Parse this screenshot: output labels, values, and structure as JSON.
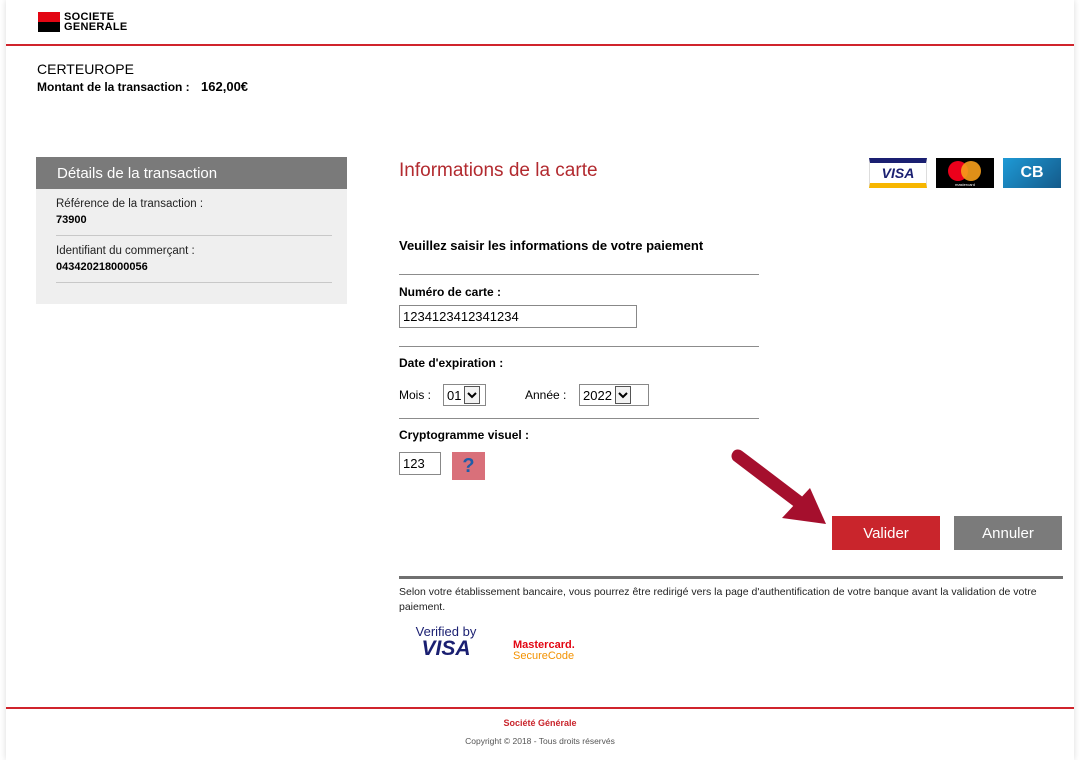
{
  "header": {
    "logo_line1": "SOCIETE",
    "logo_line2": "GENERALE"
  },
  "merchant": {
    "name": "CERTEUROPE",
    "amount_label": "Montant de la transaction :",
    "amount_value": "162,00€"
  },
  "details": {
    "title": "Détails de la transaction",
    "rows": [
      {
        "label": "Référence de la transaction :",
        "value": "73900"
      },
      {
        "label": "Identifiant du commerçant :",
        "value": "043420218000056"
      }
    ]
  },
  "form": {
    "title": "Informations de la carte",
    "prompt": "Veuillez saisir les informations de votre paiement",
    "card_number_label": "Numéro de carte :",
    "card_number_value": "1234123412341234",
    "expiry_label": "Date d'expiration :",
    "month_label": "Mois :",
    "month_value": "01",
    "year_label": "Année :",
    "year_value": "2022",
    "cvv_label": "Cryptogramme visuel :",
    "cvv_value": "123",
    "help_label": "?",
    "validate_label": "Valider",
    "cancel_label": "Annuler"
  },
  "brands": {
    "visa": "VISA",
    "mastercard": "mastercard",
    "cb": "CB"
  },
  "notice": "Selon votre établissement bancaire, vous pourrez être redirigé vers la page d'authentification de votre banque avant la validation de votre paiement.",
  "security": {
    "vbv_line1": "Verified by",
    "vbv_line2": "VISA",
    "mc_line1": "Mastercard.",
    "mc_line2": "SecureCode"
  },
  "footer": {
    "brand": "Société Générale",
    "copyright": "Copyright © 2018 - Tous droits réservés"
  },
  "colors": {
    "brand_red": "#d0242c",
    "title_red": "#b22a2f",
    "cancel_gray": "#7b7b7b",
    "arrow_red": "#a50f2d"
  }
}
